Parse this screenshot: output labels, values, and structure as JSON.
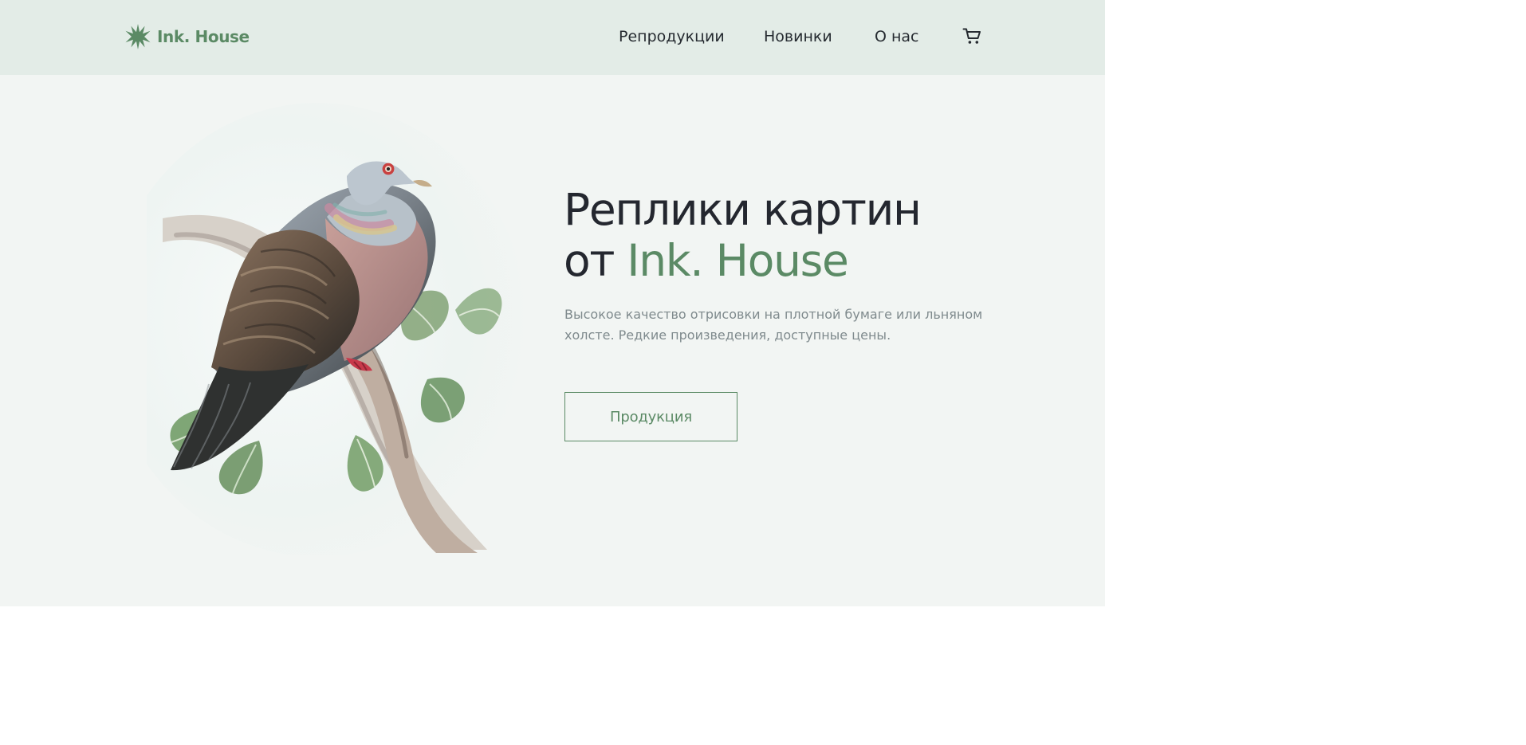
{
  "brand": {
    "name": "Ink. House",
    "accent_color": "#5b8a65",
    "logo_icon": "green-star-icon"
  },
  "navigation": {
    "items": [
      {
        "label": "Репродукции"
      },
      {
        "label": "Новинки"
      },
      {
        "label": "О нас"
      }
    ],
    "cart_icon": "shopping-cart-icon"
  },
  "hero": {
    "title_line_1": "Реплики картин",
    "title_prefix": "от",
    "title_brand": "Ink. House",
    "description": "Высокое качество отрисовки на плотной бумаге или льняном холсте. Редкие произведения, доступные цены.",
    "button_label": "Продукция",
    "image_subject": "pigeon-illustration"
  },
  "colors": {
    "header_background": "#e3ece7",
    "page_background": "#f2f5f3",
    "text_dark": "#24272f",
    "text_muted": "#7f8a8d"
  }
}
